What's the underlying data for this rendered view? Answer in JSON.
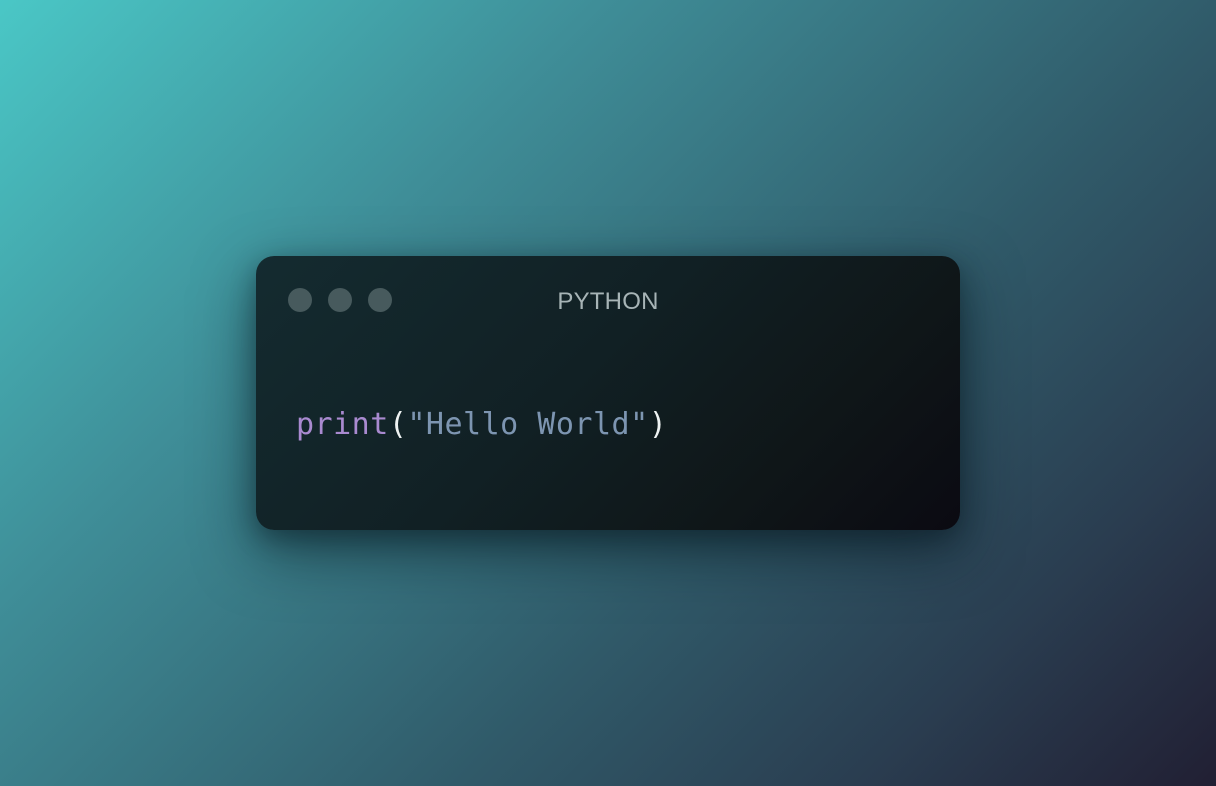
{
  "window": {
    "title": "PYTHON",
    "controls": [
      "window-dot-1",
      "window-dot-2",
      "window-dot-3"
    ]
  },
  "code": {
    "language": "python",
    "tokens": {
      "func": "print",
      "open_paren": "(",
      "string": "\"Hello World\"",
      "close_paren": ")"
    }
  },
  "colors": {
    "background_start": "#4ac7c6",
    "background_end": "#211f33",
    "window_bg": "#112024",
    "dot": "#475a5d",
    "title": "#a7b4b6",
    "keyword": "#a98ad0",
    "string": "#7d95b1",
    "punctuation": "#eef2f2"
  }
}
